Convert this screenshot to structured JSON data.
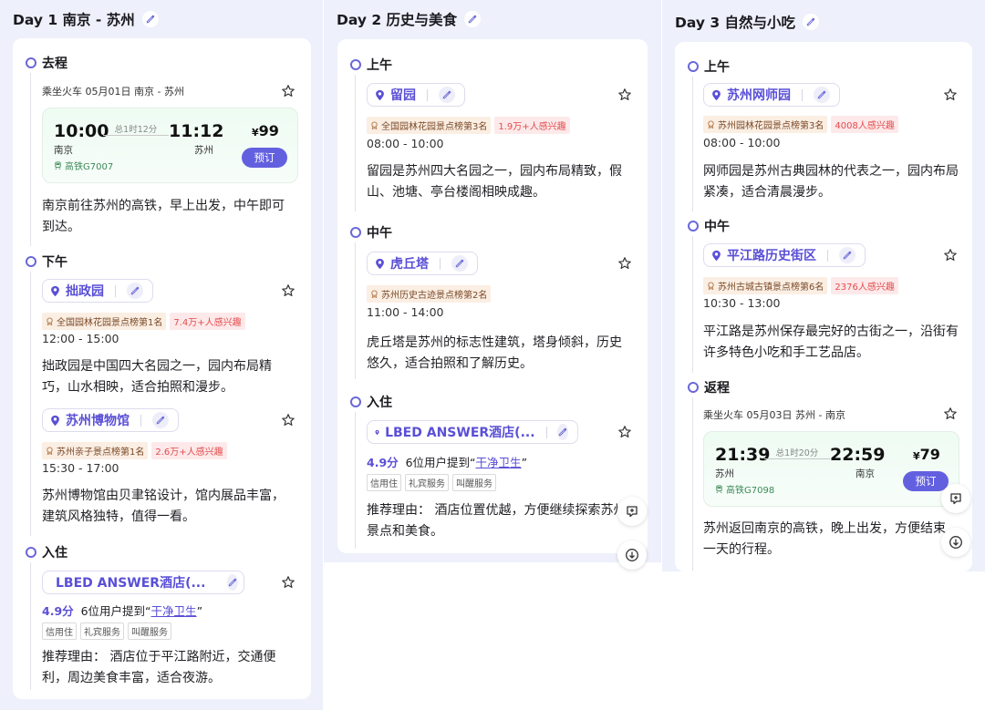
{
  "days": [
    {
      "title": "Day 1 南京 - 苏州",
      "sections": {
        "depart": "去程",
        "afternoon": "下午",
        "stay": "入住"
      },
      "train": {
        "summary": "乘坐火车 05月01日 南京 - 苏州",
        "dep_time": "10:00",
        "arr_time": "11:12",
        "duration": "总1时12分",
        "dep_station": "南京",
        "arr_station": "苏州",
        "train_no": "高铁G7007",
        "price_symbol": "¥",
        "price": "99",
        "book_label": "预订"
      },
      "depart_desc": "南京前往苏州的高铁，早上出发，中午即可到达。",
      "pois": [
        {
          "name": "拙政园",
          "rank": "全国园林花园景点榜第1名",
          "hot": "7.4万+人感兴趣",
          "time": "12:00 - 15:00",
          "desc": "拙政园是中国四大名园之一，园内布局精巧，山水相映，适合拍照和漫步。"
        },
        {
          "name": "苏州博物馆",
          "rank": "苏州亲子景点榜第1名",
          "hot": "2.6万+人感兴趣",
          "time": "15:30 - 17:00",
          "desc": "苏州博物馆由贝聿铭设计，馆内展品丰富，建筑风格独特，值得一看。"
        }
      ],
      "hotel": {
        "name": "LBED ANSWER酒店(...",
        "score": "4.9分",
        "mention_prefix": "6位用户提到“",
        "mention_kw": "干净卫生",
        "mention_suffix": "”",
        "tags": [
          "信用住",
          "礼宾服务",
          "叫醒服务"
        ],
        "reason": "推荐理由： 酒店位于平江路附近，交通便利，周边美食丰富，适合夜游。"
      }
    },
    {
      "title": "Day 2 历史与美食",
      "sections": {
        "morning": "上午",
        "noon": "中午",
        "stay": "入住"
      },
      "pois": [
        {
          "name": "留园",
          "rank": "全国园林花园景点榜第3名",
          "hot": "1.9万+人感兴趣",
          "time": "08:00 - 10:00",
          "desc": "留园是苏州四大名园之一，园内布局精致，假山、池塘、亭台楼阁相映成趣。"
        },
        {
          "name": "虎丘塔",
          "rank": "苏州历史古迹景点榜第2名",
          "hot": "",
          "time": "11:00 - 14:00",
          "desc": "虎丘塔是苏州的标志性建筑，塔身倾斜，历史悠久，适合拍照和了解历史。"
        }
      ],
      "hotel": {
        "name": "LBED ANSWER酒店(...",
        "score": "4.9分",
        "mention_prefix": "6位用户提到“",
        "mention_kw": "干净卫生",
        "mention_suffix": "”",
        "tags": [
          "信用住",
          "礼宾服务",
          "叫醒服务"
        ],
        "reason": "推荐理由： 酒店位置优越，方便继续探索苏州的景点和美食。"
      }
    },
    {
      "title": "Day 3 自然与小吃",
      "sections": {
        "morning": "上午",
        "noon": "中午",
        "return": "返程"
      },
      "pois": [
        {
          "name": "苏州网师园",
          "rank": "苏州园林花园景点榜第3名",
          "hot": "4008人感兴趣",
          "time": "08:00 - 10:00",
          "desc": "网师园是苏州古典园林的代表之一，园内布局紧凑，适合清晨漫步。"
        },
        {
          "name": "平江路历史街区",
          "rank": "苏州古城古镇景点榜第6名",
          "hot": "2376人感兴趣",
          "time": "10:30 - 13:00",
          "desc": "平江路是苏州保存最完好的古街之一，沿街有许多特色小吃和手工艺品店。"
        }
      ],
      "train": {
        "summary": "乘坐火车 05月03日 苏州 - 南京",
        "dep_time": "21:39",
        "arr_time": "22:59",
        "duration": "总1时20分",
        "dep_station": "苏州",
        "arr_station": "南京",
        "train_no": "高铁G7098",
        "price_symbol": "¥",
        "price": "79",
        "book_label": "预订"
      },
      "return_desc": "苏州返回南京的高铁，晚上出发，方便结束一天的行程。"
    }
  ],
  "colors": {
    "accent": "#6360e0",
    "poi_text": "#5a4fd6",
    "hot_red": "#e34c4c",
    "background": "#eef0fb"
  },
  "icons": [
    "edit-pencil-icon",
    "star-icon",
    "location-pin-icon",
    "medal-icon",
    "train-icon",
    "add-note-icon",
    "download-icon"
  ]
}
